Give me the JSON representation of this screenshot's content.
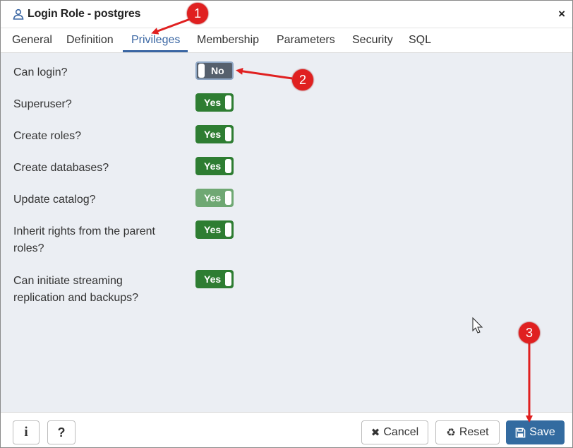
{
  "dialog": {
    "title": "Login Role - postgres",
    "close_glyph": "×"
  },
  "tabs": [
    {
      "label": "General"
    },
    {
      "label": "Definition"
    },
    {
      "label": "Privileges"
    },
    {
      "label": "Membership"
    },
    {
      "label": "Parameters"
    },
    {
      "label": "Security"
    },
    {
      "label": "SQL"
    }
  ],
  "active_tab": "Privileges",
  "fields": [
    {
      "label": "Can login?",
      "value": "No",
      "state": "off"
    },
    {
      "label": "Superuser?",
      "value": "Yes",
      "state": "on"
    },
    {
      "label": "Create roles?",
      "value": "Yes",
      "state": "on"
    },
    {
      "label": "Create databases?",
      "value": "Yes",
      "state": "on"
    },
    {
      "label": "Update catalog?",
      "value": "Yes",
      "state": "on-disabled"
    },
    {
      "label": "Inherit rights from the parent roles?",
      "value": "Yes",
      "state": "on"
    },
    {
      "label": "Can initiate streaming replication and backups?",
      "value": "Yes",
      "state": "on"
    }
  ],
  "footer": {
    "info_glyph": "i",
    "help_glyph": "?",
    "cancel_label": "Cancel",
    "reset_label": "Reset",
    "save_label": "Save"
  },
  "annotations": {
    "marker_1": "1",
    "marker_2": "2",
    "marker_3": "3"
  },
  "colors": {
    "accent": "#3a66a3",
    "toggle_on": "#2e7d32",
    "toggle_off": "#56606d",
    "save": "#336ba0",
    "marker": "#e02020"
  }
}
